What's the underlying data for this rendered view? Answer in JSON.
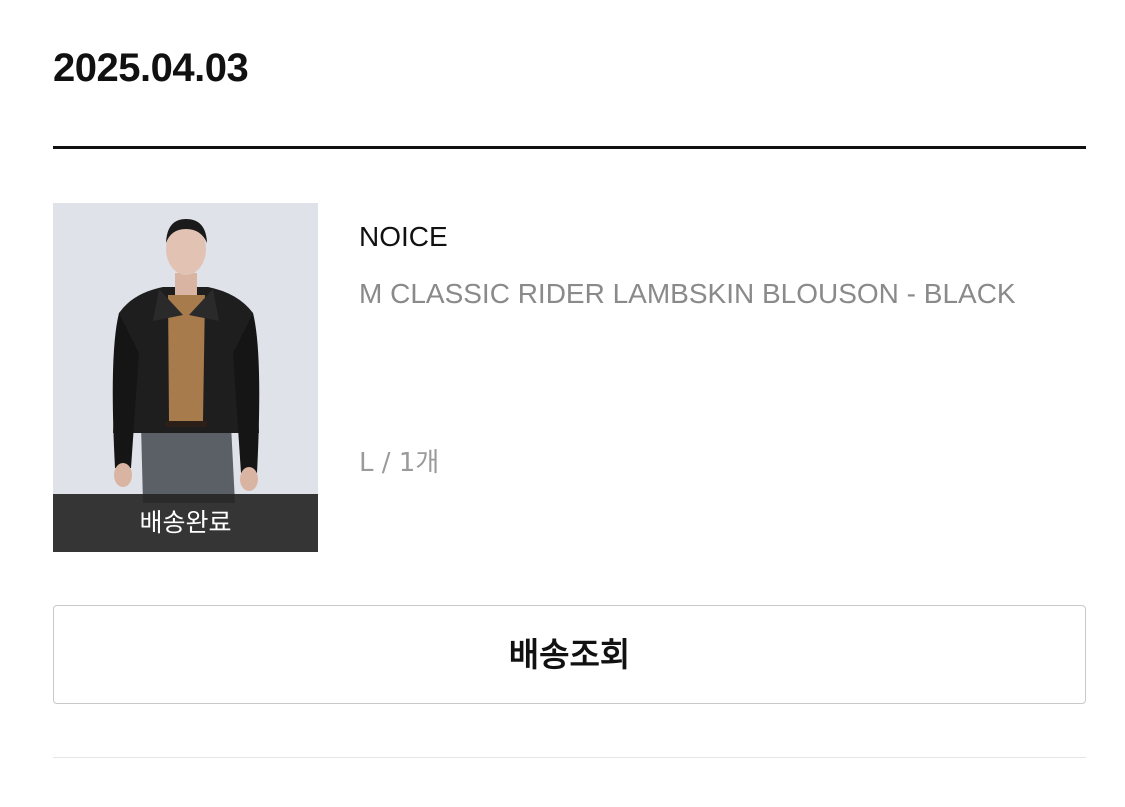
{
  "order": {
    "date": "2025.04.03"
  },
  "item": {
    "brand": "NOICE",
    "product_name": "M CLASSIC RIDER LAMBSKIN BLOUSON - BLACK",
    "option": "L / 1개",
    "status": "배송완료"
  },
  "actions": {
    "track_label": "배송조회"
  }
}
